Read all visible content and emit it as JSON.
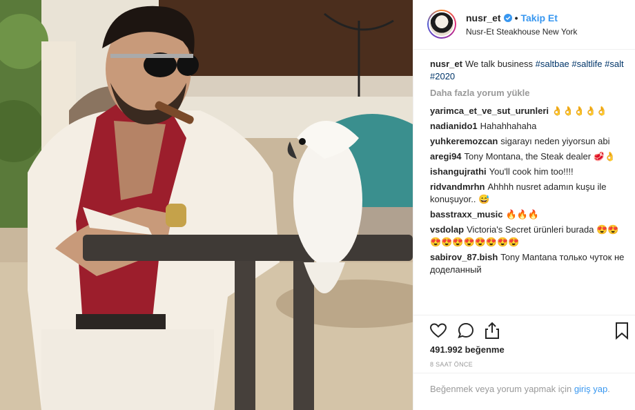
{
  "header": {
    "username": "nusr_et",
    "separator": "•",
    "follow_label": "Takip Et",
    "location": "Nusr-Et Steakhouse New York"
  },
  "caption": {
    "username": "nusr_et",
    "text": "We talk business",
    "hashtags": [
      "#saltbae",
      "#saltlife",
      "#salt",
      "#2020"
    ]
  },
  "load_more_label": "Daha fazla yorum yükle",
  "comments": [
    {
      "user": "yarimca_et_ve_sut_urunleri",
      "text": "👌👌👌👌👌"
    },
    {
      "user": "nadianido1",
      "text": "Hahahhahaha"
    },
    {
      "user": "yuhkeremozcan",
      "text": "sigarayı neden yiyorsun abi"
    },
    {
      "user": "aregi94",
      "text": "Tony Montana, the Steak dealer 🥩👌"
    },
    {
      "user": "ishangujrathi",
      "text": "You'll cook him too!!!!"
    },
    {
      "user": "ridvandmrhn",
      "text": "Ahhhh nusret adamın kuşu ile konuşuyor.. 😅"
    },
    {
      "user": "basstraxx_music",
      "text": "🔥🔥🔥"
    },
    {
      "user": "vsdolap",
      "text": "Victoria's Secret ürünleri burada 😍😍😍😍😍😍😍😍😍😍"
    },
    {
      "user": "sabirov_87.bish",
      "text": "Tony Mantana только чуток не доделанный"
    }
  ],
  "likes_text": "491.992 beğenme",
  "time_text": "8 SAAT ÖNCE",
  "login_prompt": {
    "before": "Beğenmek veya yorum yapmak için ",
    "link": "giriş yap",
    "after": "."
  },
  "icons": {
    "like": "heart-icon",
    "comment": "comment-icon",
    "share": "share-icon",
    "save": "bookmark-icon",
    "verified": "verified-badge-icon"
  },
  "colors": {
    "link_blue": "#3897f0",
    "hashtag": "#003569",
    "muted": "#999999"
  }
}
